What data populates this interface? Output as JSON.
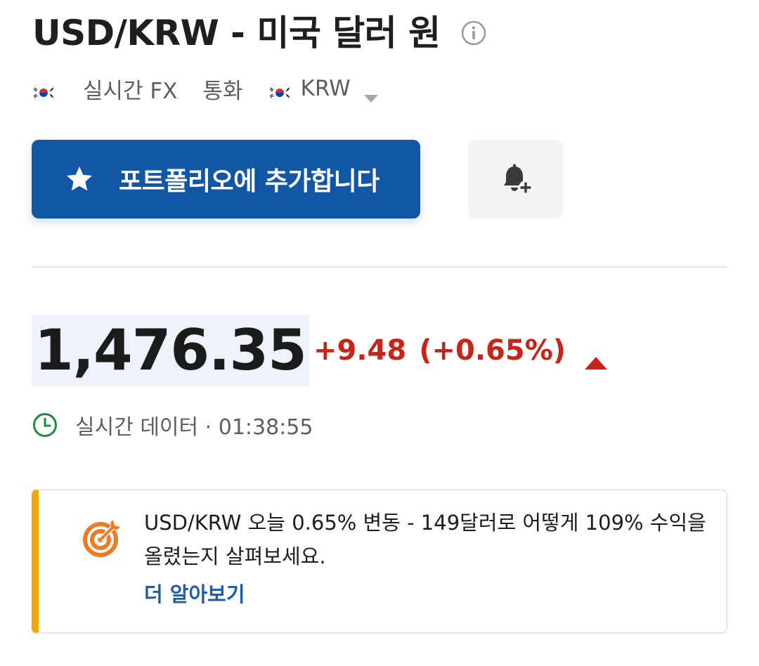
{
  "header": {
    "title": "USD/KRW - 미국 달러 원",
    "info_icon": "info-circle-icon"
  },
  "meta": {
    "market": "실시간 FX",
    "type": "통화",
    "currency": "KRW",
    "flag_icon": "korea-flag-icon",
    "dropdown_icon": "caret-down-icon"
  },
  "actions": {
    "add_portfolio_label": "포트폴리오에 추가합니다",
    "add_icon": "star-icon",
    "alert_icon": "bell-plus-icon"
  },
  "quote": {
    "price": "1,476.35",
    "change": "+9.48",
    "change_pct": "(+0.65%)",
    "direction_icon": "triangle-up-icon",
    "status": "실시간 데이터 · 01:38:55",
    "status_icon": "clock-icon"
  },
  "promo": {
    "text": "USD/KRW 오늘 0.65% 변동 - 149달러로 어떻게 109% 수익을 올렸는지 살펴보세요.",
    "link": "더 알아보기",
    "icon": "target-arrow-icon"
  },
  "colors": {
    "primary": "#1256a6",
    "negative_red": "#c8241a",
    "accent_orange": "#f2a60c",
    "clock_green": "#1c8a3c",
    "link_blue": "#1a5ea8"
  }
}
